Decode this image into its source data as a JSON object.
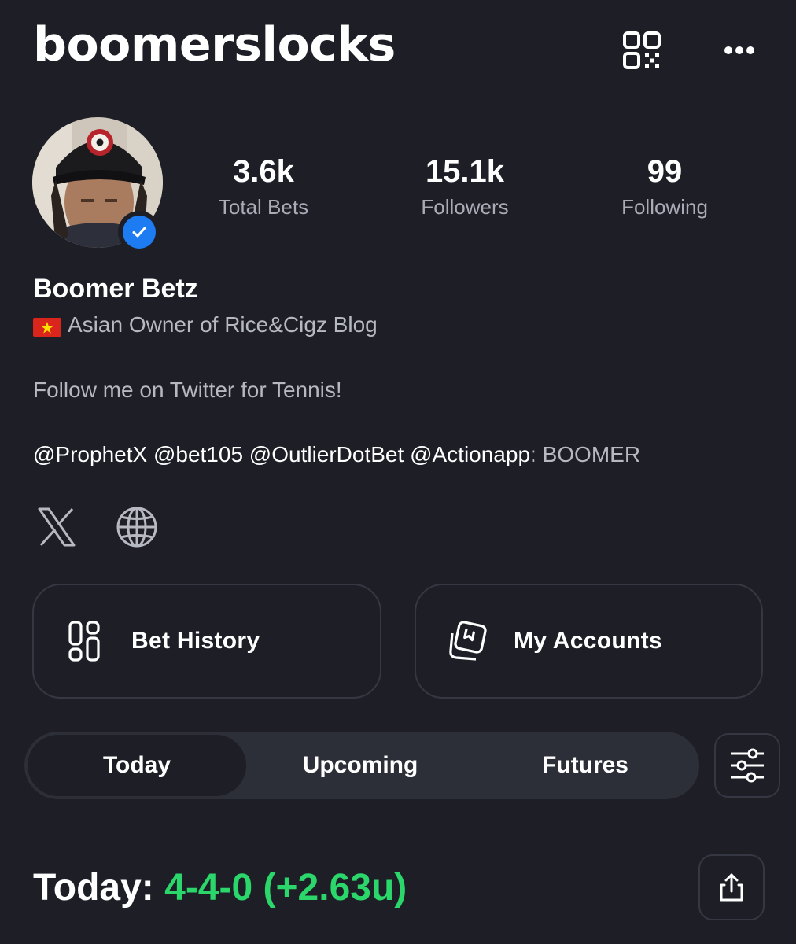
{
  "header": {
    "username": "boomerslocks",
    "qr_icon": "qr-code-icon",
    "more_icon": "more-horizontal-icon"
  },
  "profile": {
    "verified": true,
    "stats": [
      {
        "value": "3.6k",
        "label": "Total Bets"
      },
      {
        "value": "15.1k",
        "label": "Followers"
      },
      {
        "value": "99",
        "label": "Following"
      }
    ],
    "display_name": "Boomer Betz",
    "bio_line1": "Asian Owner of Rice&Cigz Blog",
    "bio_line2": "Follow me on Twitter for Tennis!",
    "mentions": "@ProphetX @bet105 @OutlierDotBet @Actionapp",
    "promo_sep": ": ",
    "promo_code": "BOOMER",
    "social_icons": [
      "x-icon",
      "globe-icon"
    ]
  },
  "actions": {
    "bet_history": "Bet History",
    "my_accounts": "My Accounts"
  },
  "tabs": {
    "items": [
      "Today",
      "Upcoming",
      "Futures"
    ],
    "active": "Today"
  },
  "summary": {
    "label": "Today:",
    "record": "4-4-0 (+2.63u)"
  },
  "colors": {
    "background": "#1d1e26",
    "accent_green": "#2bd66b",
    "verified_blue": "#1d7cf2",
    "muted_text": "#a9abb6"
  }
}
